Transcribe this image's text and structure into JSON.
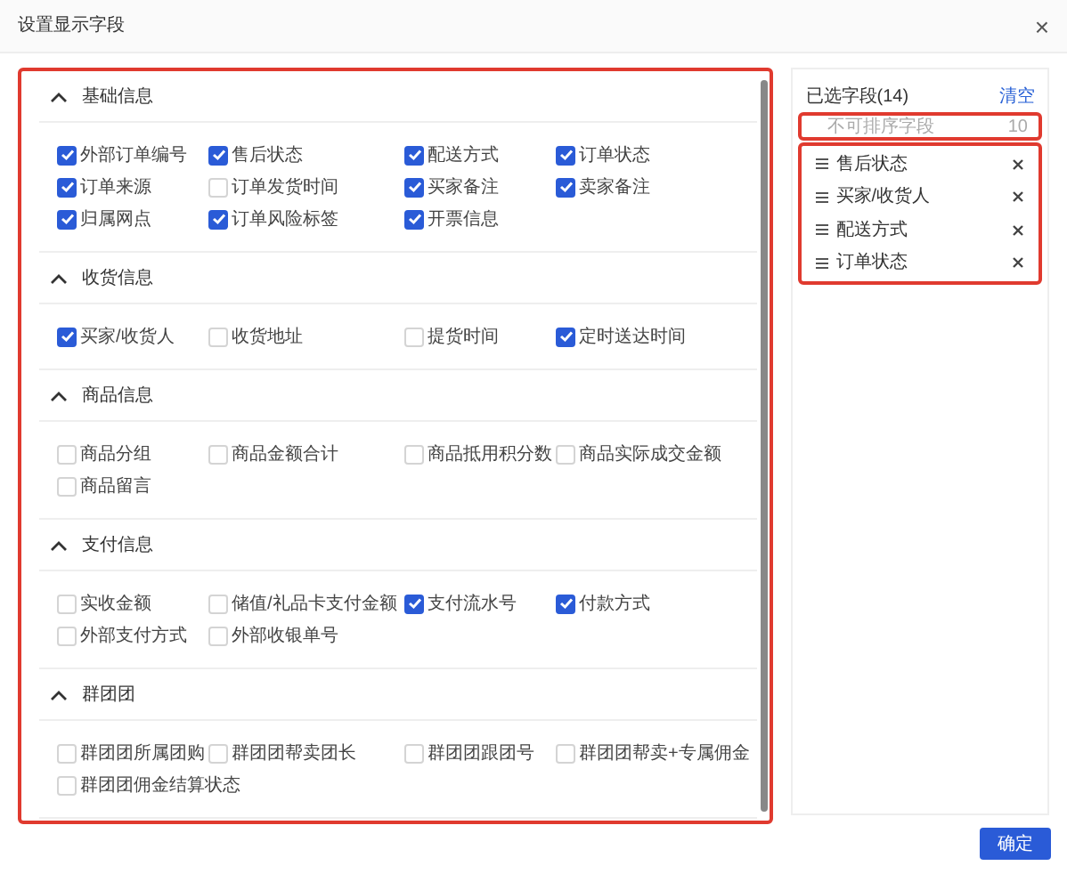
{
  "dialog": {
    "title": "设置显示字段",
    "close": "×"
  },
  "sections": [
    {
      "title": "基础信息",
      "expanded": true,
      "fields": [
        {
          "label": "外部订单编号",
          "checked": true
        },
        {
          "label": "售后状态",
          "checked": true
        },
        {
          "label": "配送方式",
          "checked": true
        },
        {
          "label": "订单状态",
          "checked": true
        },
        {
          "label": "订单来源",
          "checked": true
        },
        {
          "label": "订单发货时间",
          "checked": false
        },
        {
          "label": "买家备注",
          "checked": true
        },
        {
          "label": "卖家备注",
          "checked": true
        },
        {
          "label": "归属网点",
          "checked": true
        },
        {
          "label": "订单风险标签",
          "checked": true
        },
        {
          "label": "开票信息",
          "checked": true
        }
      ]
    },
    {
      "title": "收货信息",
      "expanded": true,
      "fields": [
        {
          "label": "买家/收货人",
          "checked": true
        },
        {
          "label": "收货地址",
          "checked": false
        },
        {
          "label": "提货时间",
          "checked": false
        },
        {
          "label": "定时送达时间",
          "checked": true
        }
      ]
    },
    {
      "title": "商品信息",
      "expanded": true,
      "fields": [
        {
          "label": "商品分组",
          "checked": false
        },
        {
          "label": "商品金额合计",
          "checked": false
        },
        {
          "label": "商品抵用积分数",
          "checked": false
        },
        {
          "label": "商品实际成交金额",
          "checked": false
        },
        {
          "label": "商品留言",
          "checked": false
        }
      ]
    },
    {
      "title": "支付信息",
      "expanded": true,
      "fields": [
        {
          "label": "实收金额",
          "checked": false
        },
        {
          "label": "储值/礼品卡支付金额",
          "checked": false
        },
        {
          "label": "支付流水号",
          "checked": true
        },
        {
          "label": "付款方式",
          "checked": true
        },
        {
          "label": "外部支付方式",
          "checked": false
        },
        {
          "label": "外部收银单号",
          "checked": false
        }
      ]
    },
    {
      "title": "群团团",
      "expanded": true,
      "fields": [
        {
          "label": "群团团所属团购",
          "checked": false
        },
        {
          "label": "群团团帮卖团长",
          "checked": false
        },
        {
          "label": "群团团跟团号",
          "checked": false
        },
        {
          "label": "群团团帮卖+专属佣金",
          "checked": false
        },
        {
          "label": "群团团佣金结算状态",
          "checked": false
        }
      ]
    }
  ],
  "selected_panel": {
    "title": "已选字段(14)",
    "clear": "清空",
    "fixed": {
      "label": "不可排序字段",
      "count": "10"
    },
    "items": [
      {
        "label": "售后状态"
      },
      {
        "label": "买家/收货人"
      },
      {
        "label": "配送方式"
      },
      {
        "label": "订单状态"
      }
    ]
  },
  "buttons": [
    "确定"
  ]
}
